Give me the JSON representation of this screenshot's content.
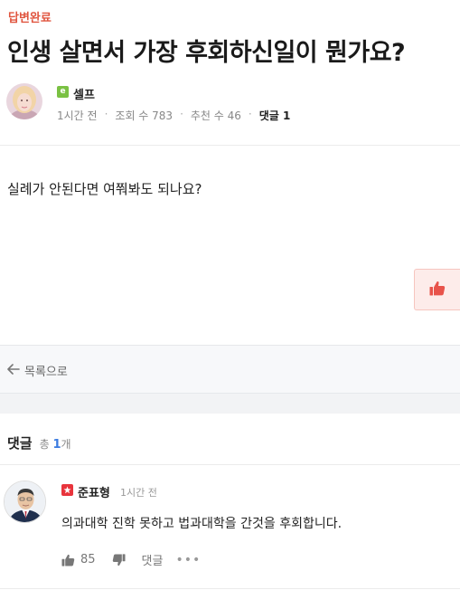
{
  "post": {
    "status": "답변완료",
    "title": "인생 살면서 가장 후회하신일이 뭔가요?",
    "author": {
      "level": "e",
      "name": "셀프"
    },
    "meta": {
      "time": "1시간 전",
      "views": "조회 수 783",
      "recommends": "추천 수 46",
      "comments": "댓글 1"
    },
    "body": "실례가 안된다면 여쭤봐도 되나요?"
  },
  "nav": {
    "back_label": "목록으로"
  },
  "comments": {
    "title": "댓글",
    "total_prefix": "총",
    "total_count": "1",
    "total_suffix": "개",
    "items": [
      {
        "author": "준표형",
        "time": "1시간 전",
        "text": "의과대학 진학 못하고 법과대학을 간것을 후회합니다.",
        "likes": "85",
        "reply_label": "댓글",
        "more": "•••"
      }
    ]
  },
  "colors": {
    "status": "#e0553f",
    "like_accent": "#e8534b",
    "count_accent": "#3b7be0",
    "badge_green": "#7ac143",
    "badge_red": "#e8343c"
  },
  "icons": {
    "level": "level-badge-icon",
    "like": "thumbs-up-icon",
    "dislike": "thumbs-down-icon",
    "back": "arrow-left-icon",
    "more": "more-dots-icon"
  }
}
